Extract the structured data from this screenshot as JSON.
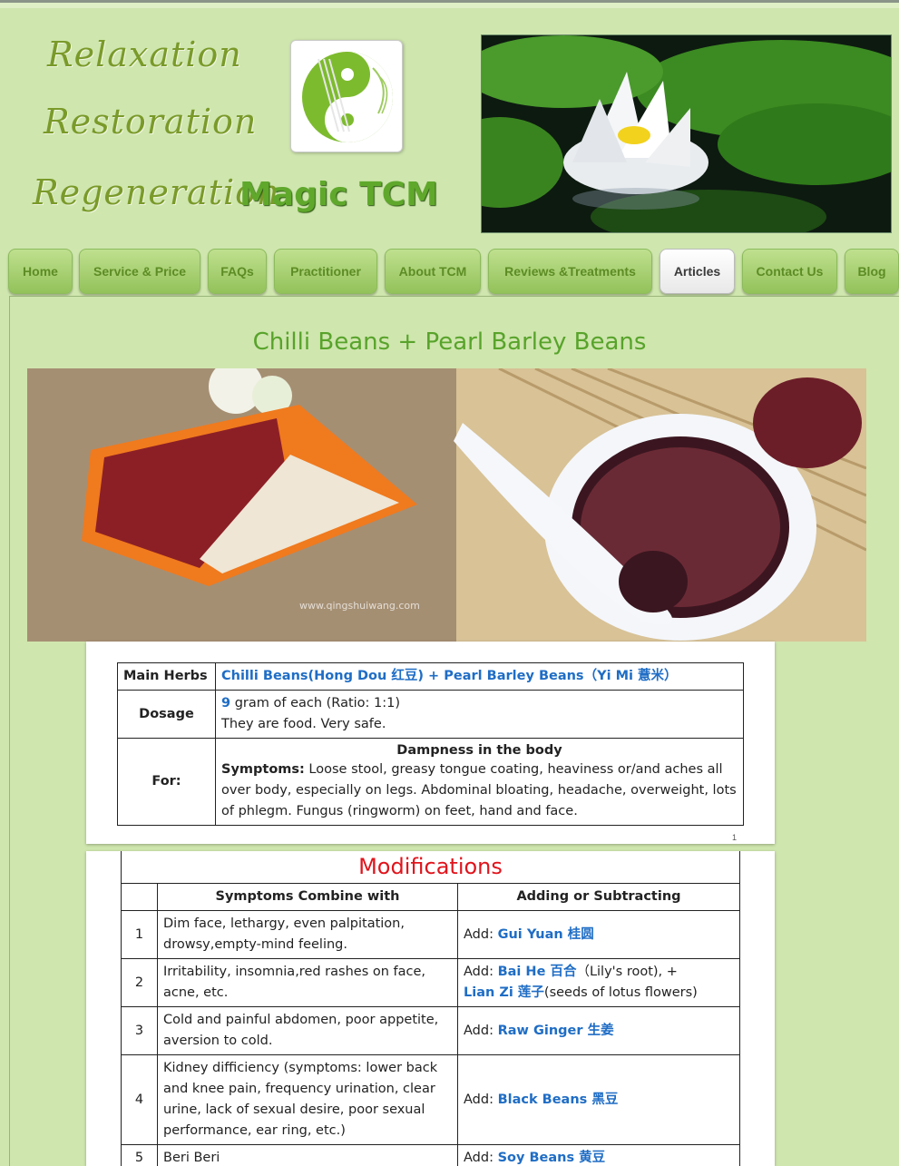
{
  "slogans": [
    "Relaxation",
    "Restoration",
    "Regeneration"
  ],
  "brand": "Magic TCM",
  "nav": {
    "items": [
      "Home",
      "Service & Price",
      "FAQs",
      "Practitioner",
      "About TCM",
      "Reviews &Treatments",
      "Articles",
      "Contact Us",
      "Blog"
    ],
    "active": "Articles"
  },
  "article": {
    "title": "Chilli Beans + Pearl Barley Beans",
    "watermark": "www.qingshuiwang.com"
  },
  "herbs_table": {
    "main_herbs_label": "Main Herbs",
    "main_herbs_value": "Chilli Beans(Hong Dou 红豆) + Pearl Barley Beans（Yi Mi 薏米）",
    "dosage_label": "Dosage",
    "dosage_number": "9",
    "dosage_line1": " gram of each (Ratio: 1:1)",
    "dosage_line2": "They are food. Very safe.",
    "for_label": "For:",
    "for_heading": "Dampness in the body",
    "symptoms_label": "Symptoms:",
    "symptoms_text": " Loose stool, greasy tongue coating, heaviness or/and aches all over body, especially on legs. Abdominal bloating, headache, overweight, lots of phlegm. Fungus (ringworm) on feet, hand and face.",
    "page_number": "1"
  },
  "modifications": {
    "title": "Modifications",
    "col_symptoms": "Symptoms Combine with",
    "col_adding": "Adding or Subtracting",
    "rows": [
      {
        "n": "1",
        "symptoms": "Dim face, lethargy, even palpitation, drowsy,empty-mind feeling.",
        "add": "Add: ",
        "herb": "Gui Yuan 桂圆",
        "extra": ""
      },
      {
        "n": "2",
        "symptoms": "Irritability, insomnia,red rashes on face, acne, etc.",
        "add": "Add: ",
        "herb": "Bai He 百合",
        "extra": "（Lily's root), +",
        "herb2": "Lian Zi 莲子",
        "extra2": "(seeds of lotus flowers)"
      },
      {
        "n": "3",
        "symptoms": "Cold and painful abdomen, poor appetite, aversion to cold.",
        "add": "Add: ",
        "herb": "Raw Ginger 生姜",
        "extra": ""
      },
      {
        "n": "4",
        "symptoms": "Kidney difficiency (symptoms: lower back and knee pain, frequency urination, clear urine, lack of sexual desire, poor sexual performance, ear ring, etc.)",
        "add": "Add: ",
        "herb": "Black Beans 黑豆",
        "extra": ""
      },
      {
        "n": "5",
        "symptoms": "Beri Beri",
        "add": "Add: ",
        "herb": "Soy Beans 黄豆",
        "extra": ""
      }
    ]
  },
  "colors": {
    "accent": "#5fa82c",
    "background": "#cfe6ae",
    "link_blue": "#1f6dc5",
    "mods_red": "#e0141c"
  }
}
